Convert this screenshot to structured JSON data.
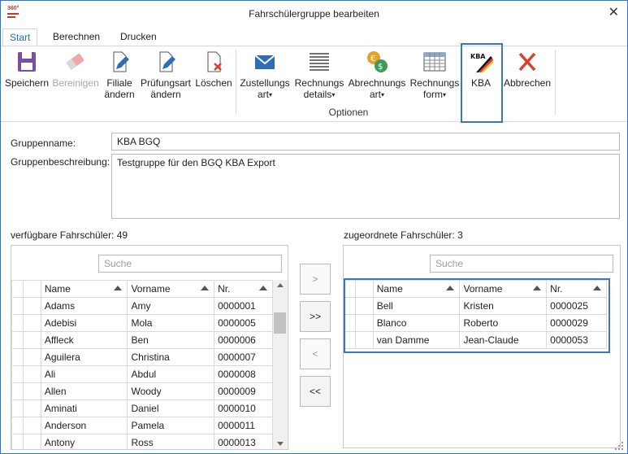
{
  "window": {
    "title": "Fahrschülergruppe bearbeiten",
    "logo_text": "360°"
  },
  "tabs": [
    {
      "label": "Start"
    },
    {
      "label": "Berechnen"
    },
    {
      "label": "Drucken"
    }
  ],
  "ribbon": {
    "save": {
      "label": "Speichern"
    },
    "clear": {
      "label": "Bereinigen"
    },
    "branch": {
      "line1": "Filiale",
      "line2": "ändern"
    },
    "examtype": {
      "line1": "Prüfungsart",
      "line2": "ändern"
    },
    "delete": {
      "label": "Löschen"
    },
    "delivery": {
      "line1": "Zustellungs",
      "line2": "art"
    },
    "invoice_details": {
      "line1": "Rechnungs",
      "line2": "details"
    },
    "billing_type": {
      "line1": "Abrechnungs",
      "line2": "art"
    },
    "invoice_form": {
      "line1": "Rechnungs",
      "line2": "form"
    },
    "kba": {
      "label": "KBA",
      "icon_text": "KBA"
    },
    "cancel": {
      "label": "Abbrechen"
    },
    "group_label": "Optionen",
    "colors": {
      "accent": "#3d78b5",
      "save": "#7a4fa0",
      "cancel": "#d9412e",
      "mail": "#2f6db5",
      "coin_gold": "#e7a22b",
      "coin_green": "#3e9a5a"
    }
  },
  "form": {
    "group_name_label": "Gruppenname:",
    "group_name_value": "KBA BGQ",
    "group_desc_label": "Gruppenbeschreibung:",
    "group_desc_value": "Testgruppe für den BGQ KBA Export"
  },
  "available": {
    "label": "verfügbare Fahrschüler: 49",
    "search_placeholder": "Suche",
    "columns": {
      "name": "Name",
      "first": "Vorname",
      "nr": "Nr."
    },
    "rows": [
      {
        "name": "Adams",
        "first": "Amy",
        "nr": "0000001"
      },
      {
        "name": "Adebisi",
        "first": "Mola",
        "nr": "0000005"
      },
      {
        "name": "Affleck",
        "first": "Ben",
        "nr": "0000006"
      },
      {
        "name": "Aguilera",
        "first": "Christina",
        "nr": "0000007"
      },
      {
        "name": "Ali",
        "first": "Abdul",
        "nr": "0000008"
      },
      {
        "name": "Allen",
        "first": "Woody",
        "nr": "0000009"
      },
      {
        "name": "Aminati",
        "first": "Daniel",
        "nr": "0000010"
      },
      {
        "name": "Anderson",
        "first": "Pamela",
        "nr": "0000011"
      },
      {
        "name": "Antony",
        "first": "Ross",
        "nr": "0000013"
      }
    ]
  },
  "assigned": {
    "label": "zugeordnete Fahrschüler: 3",
    "search_placeholder": "Suche",
    "columns": {
      "name": "Name",
      "first": "Vorname",
      "nr": "Nr."
    },
    "rows": [
      {
        "name": "Bell",
        "first": "Kristen",
        "nr": "0000025"
      },
      {
        "name": "Blanco",
        "first": "Roberto",
        "nr": "0000029"
      },
      {
        "name": "van Damme",
        "first": "Jean-Claude",
        "nr": "0000053"
      }
    ]
  },
  "move_buttons": {
    "add_one": ">",
    "add_all": ">>",
    "remove_one": "<",
    "remove_all": "<<"
  }
}
